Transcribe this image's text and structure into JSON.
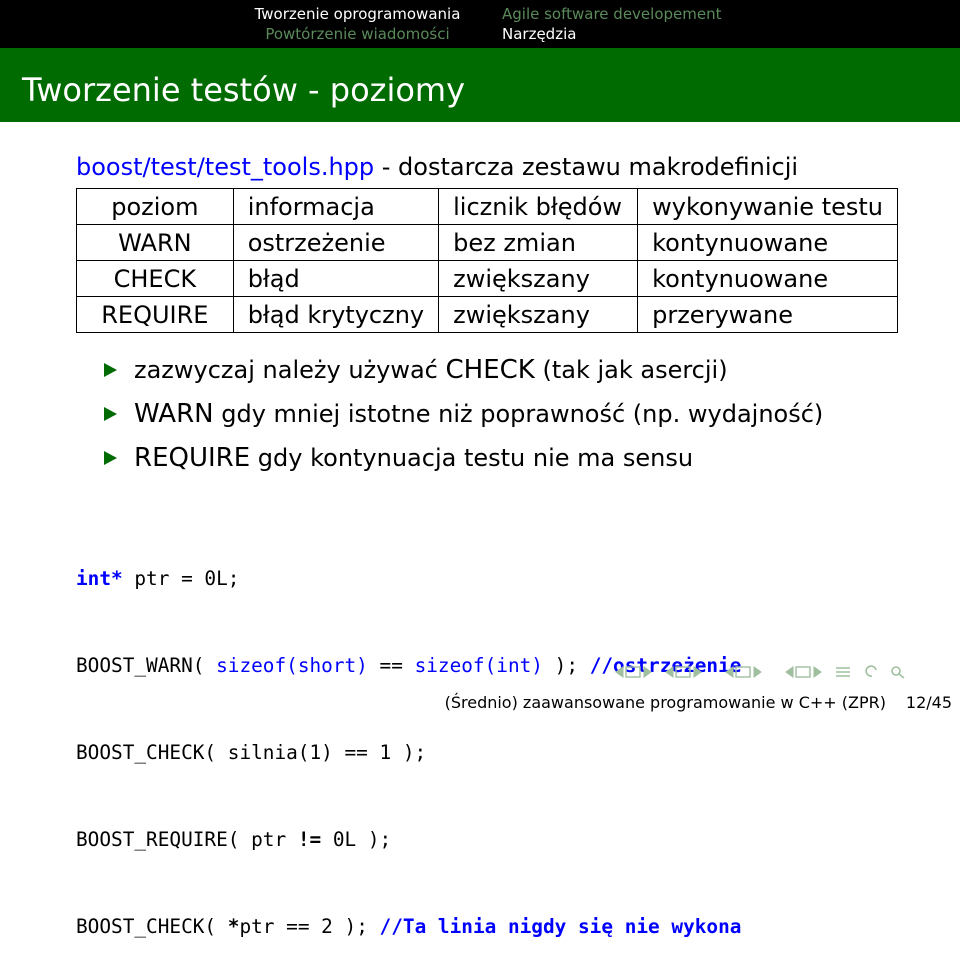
{
  "nav": {
    "left": [
      "Tworzenie oprogramowania",
      "Powtórzenie wiadomości"
    ],
    "right": [
      "Agile software developement",
      "Narzędzia"
    ]
  },
  "frame_title": "Tworzenie testów - poziomy",
  "intro": {
    "file": "boost/test/test_tools.hpp",
    "text": " - dostarcza zestawu makrodefinicji"
  },
  "table": {
    "headers": [
      "poziom",
      "informacja",
      "licznik błędów",
      "wykonywanie testu"
    ],
    "rows": [
      [
        "WARN",
        "ostrzeżenie",
        "bez zmian",
        "kontynuowane"
      ],
      [
        "CHECK",
        "błąd",
        "zwiększany",
        "kontynuowane"
      ],
      [
        "REQUIRE",
        "błąd krytyczny",
        "zwiększany",
        "przerywane"
      ]
    ]
  },
  "bullets": [
    {
      "pre": "zazwyczaj należy używać ",
      "kw": "CHECK",
      "post": " (tak jak asercji)"
    },
    {
      "pre": "",
      "kw": "WARN",
      "post": " gdy mniej istotne niż poprawność (np. wydajność)"
    },
    {
      "pre": "",
      "kw": "REQUIRE",
      "post": " gdy kontynuacja testu nie ma sensu"
    }
  ],
  "code": {
    "l1_kw": "int*",
    "l1_rest": " ptr = 0L;",
    "l2_a": "BOOST_WARN( ",
    "l2_sz1": "sizeof(short)",
    "l2_mid": " == ",
    "l2_sz2": "sizeof(int)",
    "l2_end": " ); ",
    "l2_comment": "//ostrzeżenie",
    "l3": "BOOST_CHECK( silnia(1) == 1 );",
    "l4_a": "BOOST_REQUIRE( ptr ",
    "l4_op": "!=",
    "l4_b": " 0L );",
    "l5_a": "BOOST_CHECK( ",
    "l5_star": "*",
    "l5_b": "ptr == 2 ); ",
    "l5_comment": "//Ta linia nigdy się nie wykona"
  },
  "footer": {
    "title": "(Średnio) zaawansowane programowanie w C++ (ZPR)",
    "page": "12/45"
  },
  "colors": {
    "title_bar": "#006b00",
    "nav_bg": "#000000",
    "accent_blue": "#0000ff",
    "bullet": "#006b00"
  }
}
